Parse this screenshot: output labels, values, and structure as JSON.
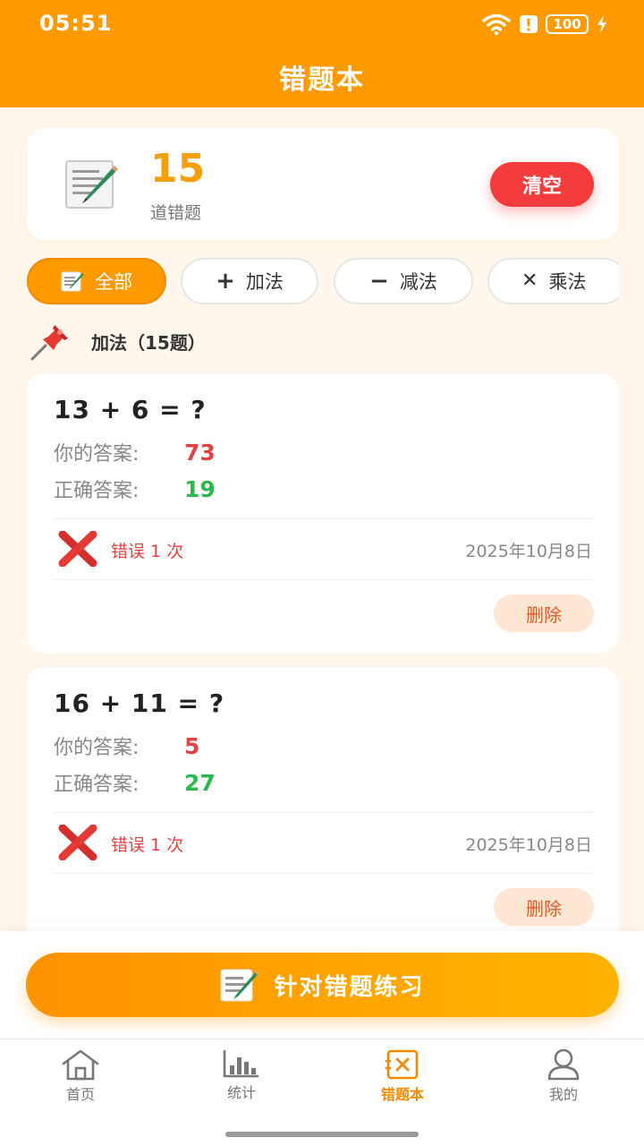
{
  "status_bar": {
    "time": "05:51",
    "battery": "100"
  },
  "header": {
    "title": "错题本"
  },
  "summary": {
    "count": "15",
    "count_label": "道错题",
    "clear_label": "清空"
  },
  "filters": [
    {
      "label": "全部",
      "icon": "memo-icon",
      "active": true
    },
    {
      "label": "加法",
      "icon": "plus-icon",
      "symbol": "+",
      "active": false
    },
    {
      "label": "减法",
      "icon": "minus-icon",
      "symbol": "−",
      "active": false
    },
    {
      "label": "乘法",
      "icon": "times-icon",
      "symbol": "✕",
      "active": false
    }
  ],
  "section": {
    "title": "加法（15题）",
    "icon": "pushpin-icon"
  },
  "labels": {
    "your_answer": "你的答案:",
    "correct_answer": "正确答案:",
    "delete": "删除"
  },
  "questions": [
    {
      "question": "13 + 6 = ?",
      "your_answer": "73",
      "correct_answer": "19",
      "error_count": "错误 1 次",
      "date": "2025年10月8日"
    },
    {
      "question": "16 + 11 = ?",
      "your_answer": "5",
      "correct_answer": "27",
      "error_count": "错误 1 次",
      "date": "2025年10月8日"
    }
  ],
  "practice_button": {
    "label": "针对错题练习",
    "icon": "memo-icon"
  },
  "tabbar": [
    {
      "label": "首页",
      "icon": "home-icon",
      "active": false
    },
    {
      "label": "统计",
      "icon": "chart-icon",
      "active": false
    },
    {
      "label": "错题本",
      "icon": "mistake-book-icon",
      "active": true
    },
    {
      "label": "我的",
      "icon": "profile-icon",
      "active": false
    }
  ],
  "colors": {
    "primary": "#FF9A00",
    "danger": "#F53C3C",
    "wrong_answer": "#E04343",
    "correct_answer": "#2BB84D",
    "background": "#FFF7EC"
  }
}
